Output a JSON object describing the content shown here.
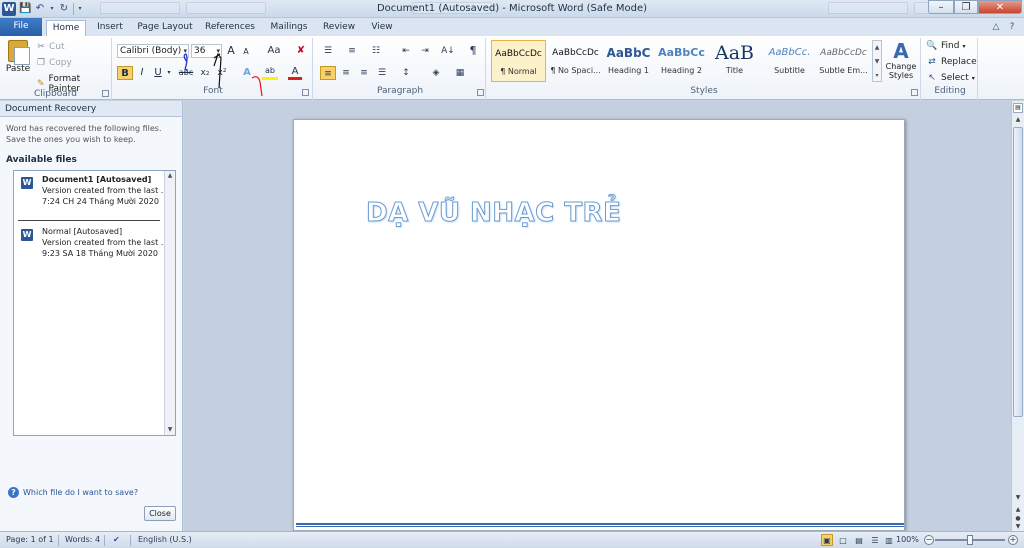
{
  "window": {
    "title": "Document1 (Autosaved)  -  Microsoft Word (Safe Mode)"
  },
  "qat": {
    "app_icon": "W",
    "save_icon": "save-icon",
    "undo_icon": "undo-icon",
    "redo_icon": "redo-icon"
  },
  "tabs": [
    {
      "label": "File"
    },
    {
      "label": "Home"
    },
    {
      "label": "Insert"
    },
    {
      "label": "Page Layout"
    },
    {
      "label": "References"
    },
    {
      "label": "Mailings"
    },
    {
      "label": "Review"
    },
    {
      "label": "View"
    }
  ],
  "clipboard": {
    "paste": "Paste",
    "cut": "Cut",
    "copy": "Copy",
    "format_painter": "Format Painter",
    "label": "Clipboard"
  },
  "font": {
    "name": "Calibri (Body)",
    "size": "36",
    "label": "Font",
    "bold": "B",
    "italic": "I",
    "underline": "U",
    "strike": "abc",
    "subscript": "x₂",
    "superscript": "x²",
    "grow": "A",
    "shrink": "A",
    "change_case": "Aa",
    "text_effects": "A",
    "highlight": "ab",
    "font_color": "A"
  },
  "paragraph": {
    "label": "Paragraph",
    "pilcrow": "¶",
    "sort": "A↓"
  },
  "styles": {
    "label": "Styles",
    "items": [
      {
        "preview": "AaBbCcDc",
        "caption": "¶ Normal"
      },
      {
        "preview": "AaBbCcDc",
        "caption": "¶ No Spaci..."
      },
      {
        "preview": "AaBbC",
        "caption": "Heading 1"
      },
      {
        "preview": "AaBbCc",
        "caption": "Heading 2"
      },
      {
        "preview": "AaB",
        "caption": "Title"
      },
      {
        "preview": "AaBbCc.",
        "caption": "Subtitle"
      },
      {
        "preview": "AaBbCcDc",
        "caption": "Subtle Em..."
      }
    ],
    "change_styles": "Change Styles"
  },
  "editing": {
    "label": "Editing",
    "find": "Find",
    "replace": "Replace",
    "select": "Select"
  },
  "recovery": {
    "header": "Document Recovery",
    "message": "Word has recovered the following files.  Save the ones you wish to keep.",
    "available": "Available files",
    "items": [
      {
        "name": "Document1  [Autosaved]",
        "line1": "Version created from the last ...",
        "line2": "7:24 CH 24 Tháng Mười 2020"
      },
      {
        "name": "Normal  [Autosaved]",
        "line1": "Version created from the last ...",
        "line2": "9:23 SA 18 Tháng Mười 2020"
      }
    ],
    "help": "Which file do I want to save?",
    "close": "Close"
  },
  "document": {
    "heading": "DẠ VŨ NHẠC TRẺ"
  },
  "status": {
    "page": "Page: 1 of 1",
    "words": "Words: 4",
    "language": "English (U.S.)",
    "zoom": "100%"
  },
  "colors": {
    "accent": "#2b5797",
    "heading_outline": "#6a9bd3",
    "selected": "#f8d16b"
  }
}
